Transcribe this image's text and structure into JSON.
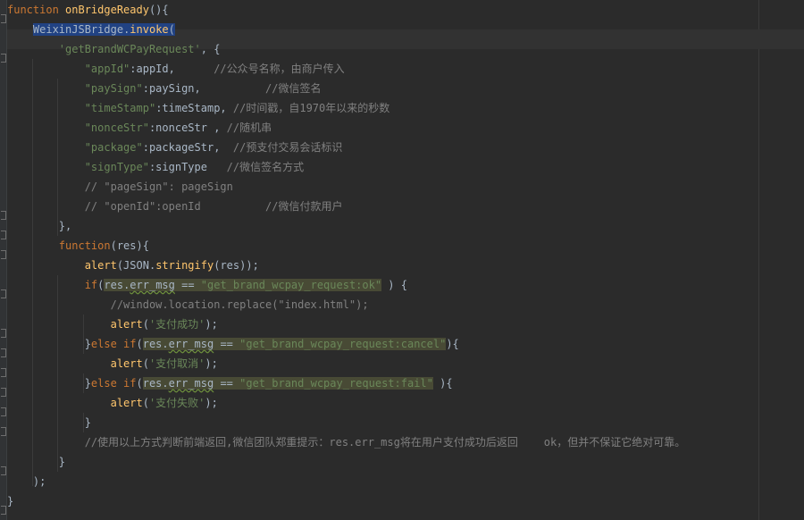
{
  "editor": {
    "language": "JavaScript",
    "theme": "Darcula",
    "colors": {
      "background": "#2b2b2b",
      "keyword": "#cc7832",
      "function": "#ffc66d",
      "string": "#6a8759",
      "comment": "#808080",
      "plain": "#a9b7c6",
      "selection": "#214283"
    },
    "lines": [
      {
        "tokens": [
          {
            "t": "kw",
            "v": "function "
          },
          {
            "t": "fn",
            "v": "onBridgeReady"
          },
          {
            "t": "pl",
            "v": "(){"
          }
        ]
      },
      {
        "tokens": [
          {
            "t": "pl",
            "v": "    "
          },
          {
            "t": "pl sel",
            "v": "WeixinJSBridge"
          },
          {
            "t": "pl sel",
            "v": "."
          },
          {
            "t": "fn sel",
            "v": "invoke"
          },
          {
            "t": "pl sel",
            "v": "("
          }
        ]
      },
      {
        "tokens": [
          {
            "t": "pl",
            "v": "        "
          },
          {
            "t": "str",
            "v": "'getBrandWCPayRequest'"
          },
          {
            "t": "pl",
            "v": ", {"
          }
        ]
      },
      {
        "tokens": [
          {
            "t": "pl",
            "v": "            "
          },
          {
            "t": "str",
            "v": "\"appId\""
          },
          {
            "t": "pl",
            "v": ":appId,      "
          },
          {
            "t": "cm",
            "v": "//公众号名称，由商户传入"
          }
        ]
      },
      {
        "tokens": [
          {
            "t": "pl",
            "v": "            "
          },
          {
            "t": "str",
            "v": "\"paySign\""
          },
          {
            "t": "pl",
            "v": ":paySign,          "
          },
          {
            "t": "cm",
            "v": "//微信签名"
          }
        ]
      },
      {
        "tokens": [
          {
            "t": "pl",
            "v": "            "
          },
          {
            "t": "str",
            "v": "\"timeStamp\""
          },
          {
            "t": "pl",
            "v": ":timeStamp, "
          },
          {
            "t": "cm",
            "v": "//时间戳，自1970年以来的秒数"
          }
        ]
      },
      {
        "tokens": [
          {
            "t": "pl",
            "v": "            "
          },
          {
            "t": "str",
            "v": "\"nonceStr\""
          },
          {
            "t": "pl",
            "v": ":nonceStr , "
          },
          {
            "t": "cm",
            "v": "//随机串"
          }
        ]
      },
      {
        "tokens": [
          {
            "t": "pl",
            "v": "            "
          },
          {
            "t": "str",
            "v": "\"package\""
          },
          {
            "t": "pl",
            "v": ":packageStr,  "
          },
          {
            "t": "cm",
            "v": "//预支付交易会话标识"
          }
        ]
      },
      {
        "tokens": [
          {
            "t": "pl",
            "v": "            "
          },
          {
            "t": "str",
            "v": "\"signType\""
          },
          {
            "t": "pl",
            "v": ":signType   "
          },
          {
            "t": "cm",
            "v": "//微信签名方式"
          }
        ]
      },
      {
        "tokens": [
          {
            "t": "pl",
            "v": "            "
          },
          {
            "t": "cm",
            "v": "// \"pageSign\": pageSign"
          }
        ]
      },
      {
        "tokens": [
          {
            "t": "pl",
            "v": "            "
          },
          {
            "t": "cm",
            "v": "// \"openId\":openId          //微信付款用户"
          }
        ]
      },
      {
        "tokens": [
          {
            "t": "pl",
            "v": "        },"
          }
        ]
      },
      {
        "tokens": [
          {
            "t": "pl",
            "v": "        "
          },
          {
            "t": "kw",
            "v": "function"
          },
          {
            "t": "pl",
            "v": "(res){"
          }
        ]
      },
      {
        "tokens": [
          {
            "t": "pl",
            "v": "            "
          },
          {
            "t": "fn",
            "v": "alert"
          },
          {
            "t": "pl",
            "v": "(JSON."
          },
          {
            "t": "fn",
            "v": "stringify"
          },
          {
            "t": "pl",
            "v": "(res));"
          }
        ]
      },
      {
        "tokens": [
          {
            "t": "pl",
            "v": "            "
          },
          {
            "t": "kw",
            "v": "if"
          },
          {
            "t": "pl",
            "v": "("
          },
          {
            "t": "pl cond",
            "v": "res."
          },
          {
            "t": "pl cond warn",
            "v": "err_msg"
          },
          {
            "t": "pl cond",
            "v": " == "
          },
          {
            "t": "str cond",
            "v": "\"get_brand_wcpay_request:ok\""
          },
          {
            "t": "pl",
            "v": " ) {"
          }
        ]
      },
      {
        "tokens": [
          {
            "t": "pl",
            "v": "                "
          },
          {
            "t": "cm",
            "v": "//window.location.replace(\"index.html\");"
          }
        ]
      },
      {
        "tokens": [
          {
            "t": "pl",
            "v": "                "
          },
          {
            "t": "fn",
            "v": "alert"
          },
          {
            "t": "pl",
            "v": "("
          },
          {
            "t": "str",
            "v": "'支付成功'"
          },
          {
            "t": "pl",
            "v": ");"
          }
        ]
      },
      {
        "tokens": [
          {
            "t": "pl",
            "v": "            }"
          },
          {
            "t": "kw",
            "v": "else if"
          },
          {
            "t": "pl",
            "v": "("
          },
          {
            "t": "pl cond",
            "v": "res."
          },
          {
            "t": "pl cond warn",
            "v": "err_msg"
          },
          {
            "t": "pl cond",
            "v": " == "
          },
          {
            "t": "str cond",
            "v": "\"get_brand_wcpay_request:cancel\""
          },
          {
            "t": "pl",
            "v": "){"
          }
        ]
      },
      {
        "tokens": [
          {
            "t": "pl",
            "v": "                "
          },
          {
            "t": "fn",
            "v": "alert"
          },
          {
            "t": "pl",
            "v": "("
          },
          {
            "t": "str",
            "v": "'支付取消'"
          },
          {
            "t": "pl",
            "v": ");"
          }
        ]
      },
      {
        "tokens": [
          {
            "t": "pl",
            "v": "            }"
          },
          {
            "t": "kw",
            "v": "else if"
          },
          {
            "t": "pl",
            "v": "("
          },
          {
            "t": "pl cond",
            "v": "res."
          },
          {
            "t": "pl cond warn",
            "v": "err_msg"
          },
          {
            "t": "pl cond",
            "v": " == "
          },
          {
            "t": "str cond",
            "v": "\"get_brand_wcpay_request:fail\""
          },
          {
            "t": "pl",
            "v": " ){"
          }
        ]
      },
      {
        "tokens": [
          {
            "t": "pl",
            "v": "                "
          },
          {
            "t": "fn",
            "v": "alert"
          },
          {
            "t": "pl",
            "v": "("
          },
          {
            "t": "str",
            "v": "'支付失败'"
          },
          {
            "t": "pl",
            "v": ");"
          }
        ]
      },
      {
        "tokens": [
          {
            "t": "pl",
            "v": "            }"
          }
        ]
      },
      {
        "tokens": [
          {
            "t": "pl",
            "v": "            "
          },
          {
            "t": "cm",
            "v": "//使用以上方式判断前端返回,微信团队郑重提示：res.err_msg将在用户支付成功后返回    ok，但并不保证它绝对可靠。"
          }
        ]
      },
      {
        "tokens": [
          {
            "t": "pl",
            "v": "        }"
          }
        ]
      },
      {
        "tokens": [
          {
            "t": "pl",
            "v": "    "
          },
          {
            "t": "pl",
            "v": ");"
          }
        ]
      },
      {
        "tokens": [
          {
            "t": "pl",
            "v": "}"
          }
        ]
      }
    ]
  }
}
